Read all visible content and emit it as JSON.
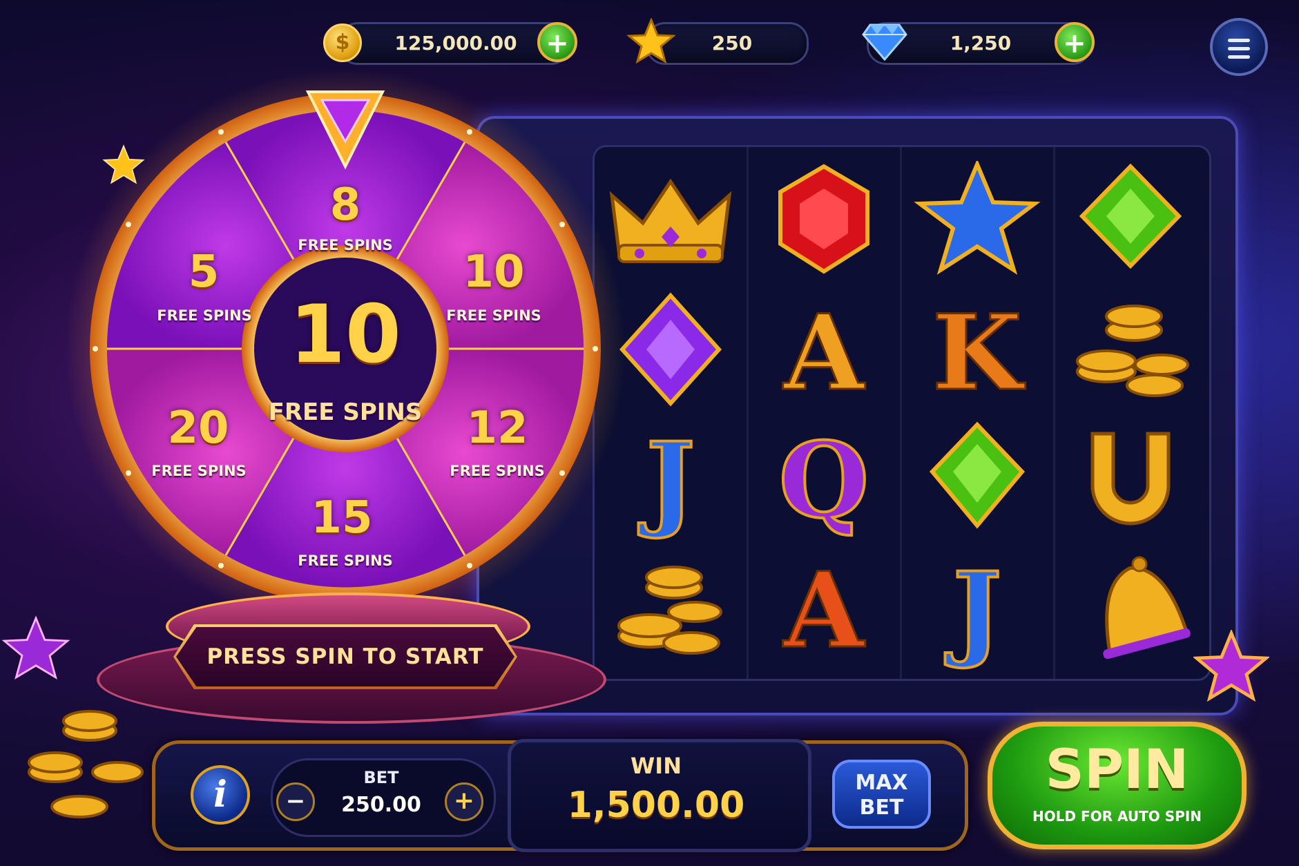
{
  "currency": {
    "coins": {
      "value": "125,000.00",
      "icon": "gold-coin-icon",
      "icon_glyph": "$",
      "action": "+"
    },
    "stars": {
      "value": "250",
      "icon": "star-icon"
    },
    "gems": {
      "value": "1,250",
      "icon": "diamond-icon",
      "action": "+"
    }
  },
  "menu": {
    "icon": "hamburger-menu-icon"
  },
  "wheel": {
    "pointer_icon": "purple-gem-pointer-icon",
    "segments": [
      {
        "number": "8",
        "label": "FREE SPINS"
      },
      {
        "number": "10",
        "label": "FREE SPINS"
      },
      {
        "number": "12",
        "label": "FREE SPINS"
      },
      {
        "number": "15",
        "label": "FREE SPINS"
      },
      {
        "number": "20",
        "label": "FREE SPINS"
      },
      {
        "number": "5",
        "label": "FREE SPINS"
      }
    ],
    "center": {
      "number": "10",
      "label": "FREE SPINS"
    },
    "prompt": "PRESS SPIN TO START"
  },
  "reels": {
    "columns": [
      [
        "crown-icon",
        "purple-diamond-icon",
        "J",
        "gold-coins-icon"
      ],
      [
        "red-gem-icon",
        "A",
        "Q",
        "A"
      ],
      [
        "blue-star-icon",
        "K",
        "green-gem-icon",
        "J"
      ],
      [
        "green-gem-icon",
        "gold-coins-icon",
        "horseshoe-icon",
        "bell-icon"
      ]
    ]
  },
  "bottom_bar": {
    "info_label": "i",
    "bet": {
      "label": "BET",
      "value": "250.00",
      "minus": "−",
      "plus": "+"
    },
    "win": {
      "label": "WIN",
      "value": "1,500.00"
    },
    "max_bet": {
      "line1": "MAX",
      "line2": "BET"
    },
    "spin": {
      "label": "SPIN",
      "sublabel": "HOLD FOR AUTO SPIN"
    }
  },
  "colors": {
    "gold": "#ffd24a",
    "purple": "#9a2ad8",
    "magenta": "#d03ab0",
    "green": "#2a9a16",
    "navy": "#0c0f33"
  }
}
